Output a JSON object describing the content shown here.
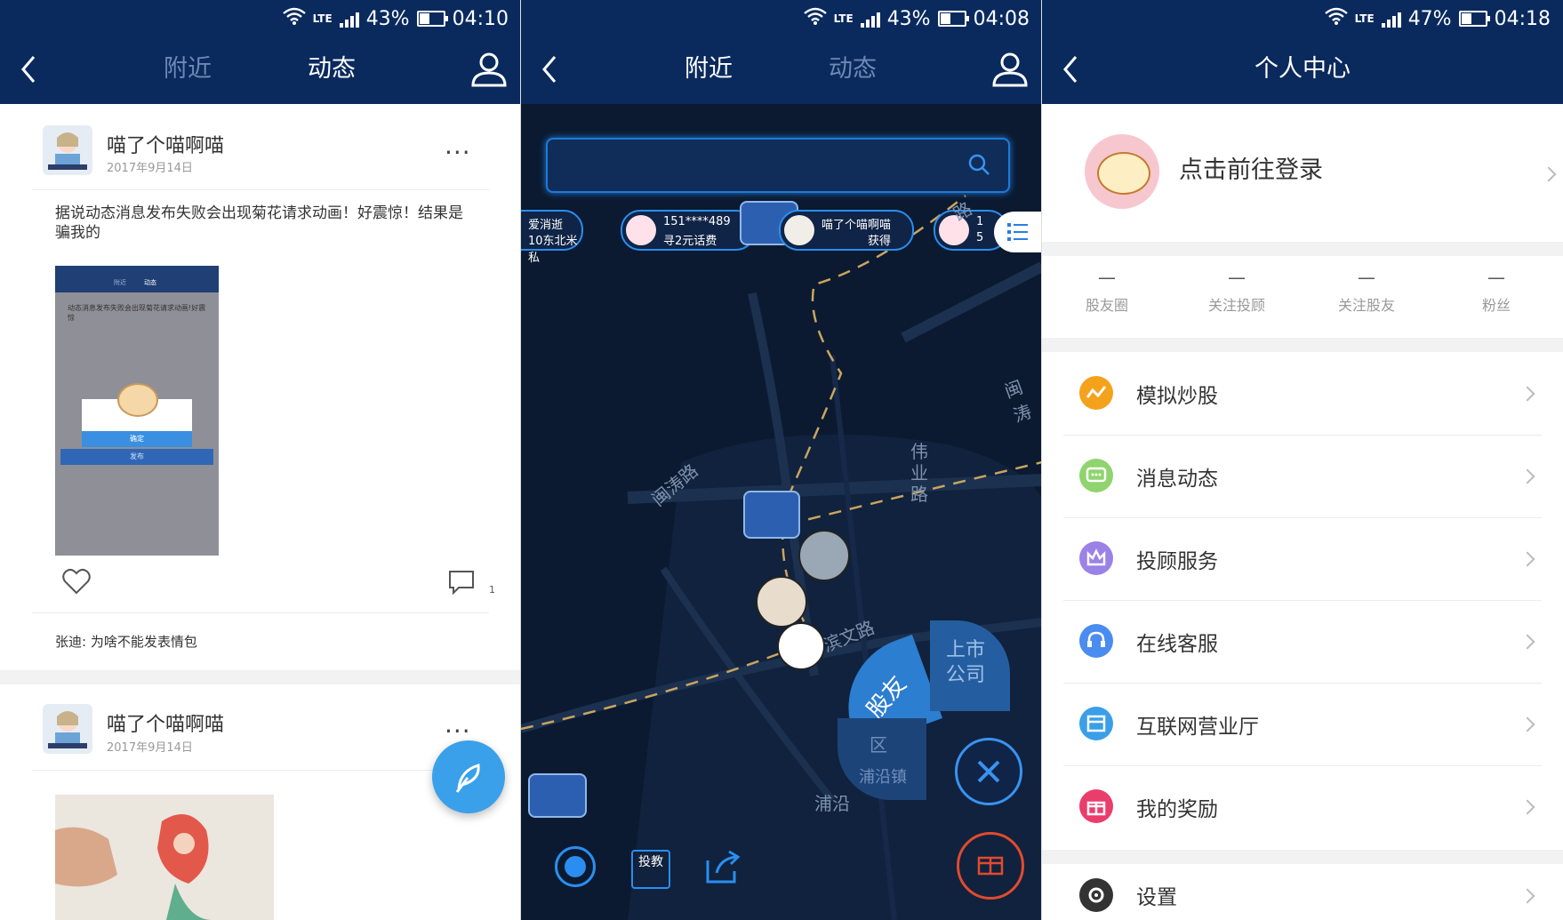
{
  "screens": {
    "nearby_feed": {
      "status": {
        "battery": "43%",
        "time": "04:10",
        "network": "LTE"
      },
      "tabs": {
        "nearby": "附近",
        "feed": "动态"
      },
      "posts": [
        {
          "user": "喵了个喵啊喵",
          "date": "2017年9月14日",
          "text": "据说动态消息发布失败会出现菊花请求动画！好震惊！结果是骗我的",
          "comment_count": "1",
          "comment": "张迪: 为啥不能发表情包",
          "image_caption": "动态消息发布失败会出现菊花请求动画!好震惊",
          "image_button": "确定",
          "image_button2": "发布",
          "image_tab1": "附近",
          "image_tab2": "动态"
        },
        {
          "user": "喵了个喵啊喵",
          "date": "2017年9月14日"
        }
      ]
    },
    "map": {
      "status": {
        "battery": "43%",
        "time": "04:08",
        "network": "LTE"
      },
      "tabs": {
        "nearby": "附近",
        "feed": "动态"
      },
      "chips": [
        {
          "line1": "爱消逝",
          "line2": "10东北米私"
        },
        {
          "line1": "151****489",
          "line2": "寻2元话费"
        },
        {
          "line1": "喵了个喵啊喵",
          "line2": "获得"
        },
        {
          "line1": "1",
          "line2": "5"
        }
      ],
      "road_labels": {
        "r1": "闽涛路",
        "r2": "伟业路",
        "r3": "滨文路",
        "r4": "浦沿",
        "r5": "闽涛",
        "r6": "浦沿镇",
        "r7": "路"
      },
      "sectors": {
        "friends": "股友",
        "listed": "上市公司",
        "district": "区"
      },
      "bottom": {
        "invest": "投教"
      }
    },
    "profile": {
      "status": {
        "battery": "47%",
        "time": "04:18",
        "network": "LTE"
      },
      "title": "个人中心",
      "login": "点击前往登录",
      "stats": [
        {
          "value": "—",
          "label": "股友圈"
        },
        {
          "value": "—",
          "label": "关注投顾"
        },
        {
          "value": "—",
          "label": "关注股友"
        },
        {
          "value": "—",
          "label": "粉丝"
        }
      ],
      "menu": [
        {
          "label": "模拟炒股",
          "icon": "chart-icon",
          "color": "#f4a21c"
        },
        {
          "label": "消息动态",
          "icon": "message-icon",
          "color": "#8fd46f"
        },
        {
          "label": "投顾服务",
          "icon": "crown-icon",
          "color": "#9b82e6"
        },
        {
          "label": "在线客服",
          "icon": "headset-icon",
          "color": "#4a8cf0"
        },
        {
          "label": "互联网营业厅",
          "icon": "store-icon",
          "color": "#3a9fe8"
        },
        {
          "label": "我的奖励",
          "icon": "gift-icon",
          "color": "#ea3d6b"
        }
      ],
      "settings": "设置"
    }
  }
}
